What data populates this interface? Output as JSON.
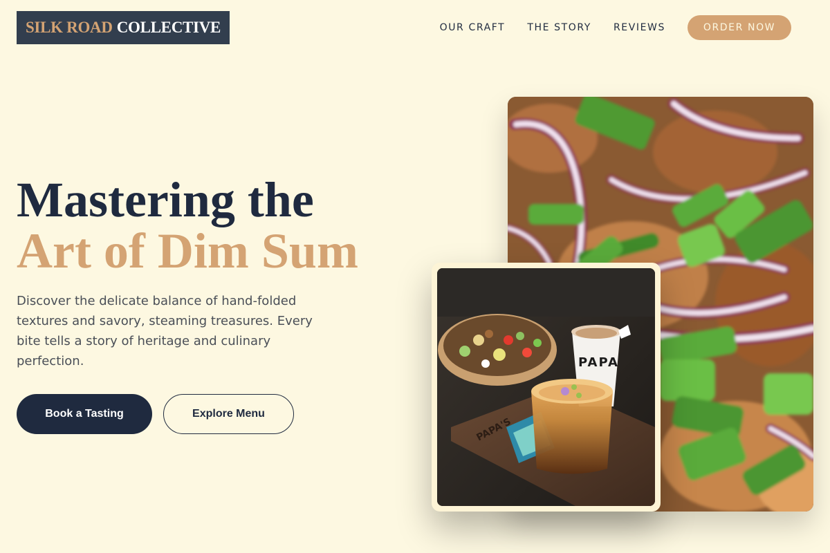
{
  "brand": {
    "accent_text": "SILK ROAD",
    "main_text": "COLLECTIVE"
  },
  "nav": {
    "items": [
      {
        "label": "OUR CRAFT"
      },
      {
        "label": "THE STORY"
      },
      {
        "label": "REVIEWS"
      }
    ],
    "cta_label": "ORDER NOW"
  },
  "hero": {
    "title_line1": "Mastering the",
    "title_line2": "Art of Dim Sum",
    "description": "Discover the delicate balance of hand-folded textures and savory, steaming treasures. Every bite tells a story of heritage and culinary perfection.",
    "primary_button": "Book a Tasting",
    "secondary_button": "Explore Menu"
  },
  "images": {
    "large": {
      "icon": "food-photo-onion-greens"
    },
    "small": {
      "icon": "food-photo-bowl-and-coffee",
      "cup_text": "PAPA",
      "tray_text": "PAPA'S"
    }
  },
  "colors": {
    "background": "#fdf8e1",
    "navy": "#1f2a3f",
    "accent": "#d4a373",
    "logo_bg": "#323e4e"
  }
}
